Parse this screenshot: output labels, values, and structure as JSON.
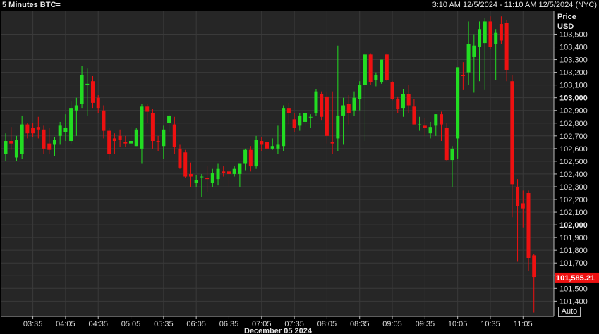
{
  "header": {
    "title": "5 Minutes BTC=",
    "range": "3:10 AM 12/5/2024 - 11:10 AM 12/5/2024 (NYC)"
  },
  "axis": {
    "price_label": "Price",
    "currency_label": "USD",
    "auto_label": "Auto",
    "date_label": "December 05 2024"
  },
  "colors": {
    "up": "#22dd22",
    "down": "#ee1111",
    "background": "#262626",
    "grid": "#3a3a3a",
    "last_price_bg": "#ee1111"
  },
  "chart_data": {
    "type": "candlestick",
    "title": "5 Minutes BTC=",
    "ylabel": "Price USD",
    "xlabel": "December 05 2024",
    "ylim": [
      101280,
      103680
    ],
    "xlim": [
      "03:10",
      "11:10"
    ],
    "y_ticks": [
      101400,
      101500,
      101600,
      101700,
      101800,
      101900,
      102000,
      102100,
      102200,
      102300,
      102400,
      102500,
      102600,
      102700,
      102800,
      102900,
      103000,
      103100,
      103200,
      103300,
      103400,
      103500
    ],
    "y_tick_labels": [
      "101,400",
      "101,500",
      "101,600",
      "101,700",
      "101,800",
      "101,900",
      "102,000",
      "102,100",
      "102,200",
      "102,300",
      "102,400",
      "102,500",
      "102,600",
      "102,700",
      "102,800",
      "102,900",
      "103,000",
      "103,100",
      "103,200",
      "103,300",
      "103,400",
      "103,500"
    ],
    "y_major_ticks": [
      102000,
      103000
    ],
    "x_ticks": [
      "03:35",
      "04:05",
      "04:35",
      "05:05",
      "05:35",
      "06:05",
      "06:35",
      "07:05",
      "07:35",
      "08:05",
      "08:35",
      "09:05",
      "09:35",
      "10:05",
      "10:35",
      "11:05"
    ],
    "last_price": 101585.21,
    "last_price_label": "101,585.21",
    "candles": [
      {
        "t": "03:10",
        "o": 102560,
        "h": 102720,
        "l": 102500,
        "c": 102660
      },
      {
        "t": "03:15",
        "o": 102660,
        "h": 102770,
        "l": 102590,
        "c": 102640
      },
      {
        "t": "03:20",
        "o": 102530,
        "h": 102700,
        "l": 102500,
        "c": 102670
      },
      {
        "t": "03:25",
        "o": 102560,
        "h": 102860,
        "l": 102520,
        "c": 102790
      },
      {
        "t": "03:30",
        "o": 102790,
        "h": 102800,
        "l": 102680,
        "c": 102720
      },
      {
        "t": "03:35",
        "o": 102760,
        "h": 102800,
        "l": 102690,
        "c": 102720
      },
      {
        "t": "03:40",
        "o": 102770,
        "h": 102850,
        "l": 102680,
        "c": 102750
      },
      {
        "t": "03:45",
        "o": 102750,
        "h": 102780,
        "l": 102560,
        "c": 102600
      },
      {
        "t": "03:50",
        "o": 102640,
        "h": 102760,
        "l": 102560,
        "c": 102590
      },
      {
        "t": "03:55",
        "o": 102630,
        "h": 102690,
        "l": 102540,
        "c": 102670
      },
      {
        "t": "04:00",
        "o": 102700,
        "h": 102810,
        "l": 102630,
        "c": 102780
      },
      {
        "t": "04:05",
        "o": 102730,
        "h": 102870,
        "l": 102660,
        "c": 102760
      },
      {
        "t": "04:10",
        "o": 102660,
        "h": 102970,
        "l": 102640,
        "c": 102920
      },
      {
        "t": "04:15",
        "o": 102900,
        "h": 103000,
        "l": 102700,
        "c": 102940
      },
      {
        "t": "04:20",
        "o": 102950,
        "h": 103250,
        "l": 102920,
        "c": 103180
      },
      {
        "t": "04:25",
        "o": 103100,
        "h": 103230,
        "l": 102860,
        "c": 103110
      },
      {
        "t": "04:30",
        "o": 103130,
        "h": 103170,
        "l": 102920,
        "c": 102960
      },
      {
        "t": "04:35",
        "o": 103000,
        "h": 103020,
        "l": 102880,
        "c": 102920
      },
      {
        "t": "04:40",
        "o": 102900,
        "h": 102940,
        "l": 102680,
        "c": 102740
      },
      {
        "t": "04:45",
        "o": 102740,
        "h": 102760,
        "l": 102510,
        "c": 102560
      },
      {
        "t": "04:50",
        "o": 102680,
        "h": 102720,
        "l": 102560,
        "c": 102660
      },
      {
        "t": "04:55",
        "o": 102700,
        "h": 102750,
        "l": 102610,
        "c": 102670
      },
      {
        "t": "05:00",
        "o": 102650,
        "h": 102700,
        "l": 102610,
        "c": 102640
      },
      {
        "t": "05:05",
        "o": 102640,
        "h": 102770,
        "l": 102620,
        "c": 102660
      },
      {
        "t": "05:10",
        "o": 102620,
        "h": 102760,
        "l": 102620,
        "c": 102750
      },
      {
        "t": "05:15",
        "o": 102600,
        "h": 102950,
        "l": 102480,
        "c": 102930
      },
      {
        "t": "05:20",
        "o": 102930,
        "h": 102950,
        "l": 102800,
        "c": 102890
      },
      {
        "t": "05:25",
        "o": 102880,
        "h": 102910,
        "l": 102600,
        "c": 102660
      },
      {
        "t": "05:30",
        "o": 102660,
        "h": 102700,
        "l": 102580,
        "c": 102650
      },
      {
        "t": "05:35",
        "o": 102620,
        "h": 102780,
        "l": 102520,
        "c": 102750
      },
      {
        "t": "05:40",
        "o": 102800,
        "h": 102870,
        "l": 102730,
        "c": 102860
      },
      {
        "t": "05:45",
        "o": 102790,
        "h": 102850,
        "l": 102560,
        "c": 102610
      },
      {
        "t": "05:50",
        "o": 102600,
        "h": 102630,
        "l": 102440,
        "c": 102450
      },
      {
        "t": "05:55",
        "o": 102570,
        "h": 102590,
        "l": 102370,
        "c": 102380
      },
      {
        "t": "06:00",
        "o": 102400,
        "h": 102490,
        "l": 102300,
        "c": 102380
      },
      {
        "t": "06:05",
        "o": 102330,
        "h": 102390,
        "l": 102300,
        "c": 102350
      },
      {
        "t": "06:10",
        "o": 102380,
        "h": 102400,
        "l": 102220,
        "c": 102380
      },
      {
        "t": "06:15",
        "o": 102370,
        "h": 102460,
        "l": 102260,
        "c": 102360
      },
      {
        "t": "06:20",
        "o": 102330,
        "h": 102440,
        "l": 102300,
        "c": 102410
      },
      {
        "t": "06:25",
        "o": 102360,
        "h": 102480,
        "l": 102310,
        "c": 102440
      },
      {
        "t": "06:30",
        "o": 102420,
        "h": 102460,
        "l": 102380,
        "c": 102410
      },
      {
        "t": "06:35",
        "o": 102420,
        "h": 102430,
        "l": 102300,
        "c": 102400
      },
      {
        "t": "06:40",
        "o": 102400,
        "h": 102460,
        "l": 102380,
        "c": 102440
      },
      {
        "t": "06:45",
        "o": 102400,
        "h": 102460,
        "l": 102300,
        "c": 102480
      },
      {
        "t": "06:50",
        "o": 102480,
        "h": 102600,
        "l": 102430,
        "c": 102590
      },
      {
        "t": "06:55",
        "o": 102590,
        "h": 102620,
        "l": 102420,
        "c": 102460
      },
      {
        "t": "07:00",
        "o": 102460,
        "h": 102700,
        "l": 102440,
        "c": 102670
      },
      {
        "t": "07:05",
        "o": 102660,
        "h": 102690,
        "l": 102580,
        "c": 102630
      },
      {
        "t": "07:10",
        "o": 102650,
        "h": 102710,
        "l": 102580,
        "c": 102600
      },
      {
        "t": "07:15",
        "o": 102600,
        "h": 102680,
        "l": 102590,
        "c": 102620
      },
      {
        "t": "07:20",
        "o": 102600,
        "h": 102780,
        "l": 102560,
        "c": 102630
      },
      {
        "t": "07:25",
        "o": 102620,
        "h": 102940,
        "l": 102580,
        "c": 102920
      },
      {
        "t": "07:30",
        "o": 102920,
        "h": 102960,
        "l": 102790,
        "c": 102880
      },
      {
        "t": "07:35",
        "o": 102830,
        "h": 102880,
        "l": 102730,
        "c": 102760
      },
      {
        "t": "07:40",
        "o": 102780,
        "h": 102880,
        "l": 102740,
        "c": 102860
      },
      {
        "t": "07:45",
        "o": 102810,
        "h": 102900,
        "l": 102770,
        "c": 102880
      },
      {
        "t": "07:50",
        "o": 102850,
        "h": 102870,
        "l": 102760,
        "c": 102850
      },
      {
        "t": "07:55",
        "o": 102880,
        "h": 103070,
        "l": 102860,
        "c": 103050
      },
      {
        "t": "08:00",
        "o": 103030,
        "h": 103050,
        "l": 102820,
        "c": 102850
      },
      {
        "t": "08:05",
        "o": 103010,
        "h": 103050,
        "l": 102640,
        "c": 102700
      },
      {
        "t": "08:10",
        "o": 102650,
        "h": 103050,
        "l": 102560,
        "c": 102640
      },
      {
        "t": "08:15",
        "o": 102680,
        "h": 103410,
        "l": 102580,
        "c": 102860
      },
      {
        "t": "08:20",
        "o": 102860,
        "h": 103000,
        "l": 102630,
        "c": 102940
      },
      {
        "t": "08:25",
        "o": 102950,
        "h": 103020,
        "l": 102790,
        "c": 102880
      },
      {
        "t": "08:30",
        "o": 102900,
        "h": 103050,
        "l": 102860,
        "c": 103000
      },
      {
        "t": "08:35",
        "o": 102990,
        "h": 103130,
        "l": 102900,
        "c": 103100
      },
      {
        "t": "08:40",
        "o": 103100,
        "h": 103350,
        "l": 102660,
        "c": 103340
      },
      {
        "t": "08:45",
        "o": 103340,
        "h": 103350,
        "l": 103100,
        "c": 103120
      },
      {
        "t": "08:50",
        "o": 103140,
        "h": 103200,
        "l": 103090,
        "c": 103180
      },
      {
        "t": "08:55",
        "o": 103120,
        "h": 103300,
        "l": 103110,
        "c": 103300
      },
      {
        "t": "09:00",
        "o": 103340,
        "h": 103350,
        "l": 103130,
        "c": 103140
      },
      {
        "t": "09:05",
        "o": 103120,
        "h": 103130,
        "l": 102980,
        "c": 102990
      },
      {
        "t": "09:10",
        "o": 102990,
        "h": 103010,
        "l": 102880,
        "c": 102910
      },
      {
        "t": "09:15",
        "o": 102920,
        "h": 103070,
        "l": 102850,
        "c": 103030
      },
      {
        "t": "09:20",
        "o": 103030,
        "h": 103100,
        "l": 102880,
        "c": 102940
      },
      {
        "t": "09:25",
        "o": 102930,
        "h": 102990,
        "l": 102790,
        "c": 102790
      },
      {
        "t": "09:30",
        "o": 102790,
        "h": 102850,
        "l": 102740,
        "c": 102790
      },
      {
        "t": "09:35",
        "o": 102780,
        "h": 102840,
        "l": 102700,
        "c": 102760
      },
      {
        "t": "09:40",
        "o": 102720,
        "h": 102810,
        "l": 102680,
        "c": 102770
      },
      {
        "t": "09:45",
        "o": 102780,
        "h": 102870,
        "l": 102700,
        "c": 102870
      },
      {
        "t": "09:50",
        "o": 102870,
        "h": 102890,
        "l": 102660,
        "c": 102790
      },
      {
        "t": "09:55",
        "o": 102760,
        "h": 102800,
        "l": 102500,
        "c": 102510
      },
      {
        "t": "10:00",
        "o": 102510,
        "h": 102620,
        "l": 102300,
        "c": 102600
      },
      {
        "t": "10:05",
        "o": 102680,
        "h": 103240,
        "l": 102520,
        "c": 103240
      },
      {
        "t": "10:10",
        "o": 103180,
        "h": 103280,
        "l": 103060,
        "c": 103170
      },
      {
        "t": "10:15",
        "o": 103200,
        "h": 103600,
        "l": 103100,
        "c": 103420
      },
      {
        "t": "10:20",
        "o": 103320,
        "h": 103500,
        "l": 103040,
        "c": 103410
      },
      {
        "t": "10:25",
        "o": 103400,
        "h": 103600,
        "l": 103130,
        "c": 103540
      },
      {
        "t": "10:30",
        "o": 103430,
        "h": 103630,
        "l": 103060,
        "c": 103600
      },
      {
        "t": "10:35",
        "o": 103600,
        "h": 103640,
        "l": 103380,
        "c": 103400
      },
      {
        "t": "10:40",
        "o": 103420,
        "h": 103540,
        "l": 103140,
        "c": 103510
      },
      {
        "t": "10:45",
        "o": 103580,
        "h": 103640,
        "l": 103420,
        "c": 103450
      },
      {
        "t": "10:50",
        "o": 103590,
        "h": 103610,
        "l": 103130,
        "c": 103220
      },
      {
        "t": "10:55",
        "o": 103130,
        "h": 103180,
        "l": 102060,
        "c": 102320
      },
      {
        "t": "11:00",
        "o": 102300,
        "h": 102360,
        "l": 101710,
        "c": 102150
      },
      {
        "t": "11:05",
        "o": 102170,
        "h": 102270,
        "l": 101980,
        "c": 102130
      },
      {
        "t": "11:10",
        "o": 102250,
        "h": 102270,
        "l": 101640,
        "c": 101740
      },
      {
        "t": "11:15",
        "o": 101760,
        "h": 101770,
        "l": 101310,
        "c": 101590
      }
    ]
  }
}
